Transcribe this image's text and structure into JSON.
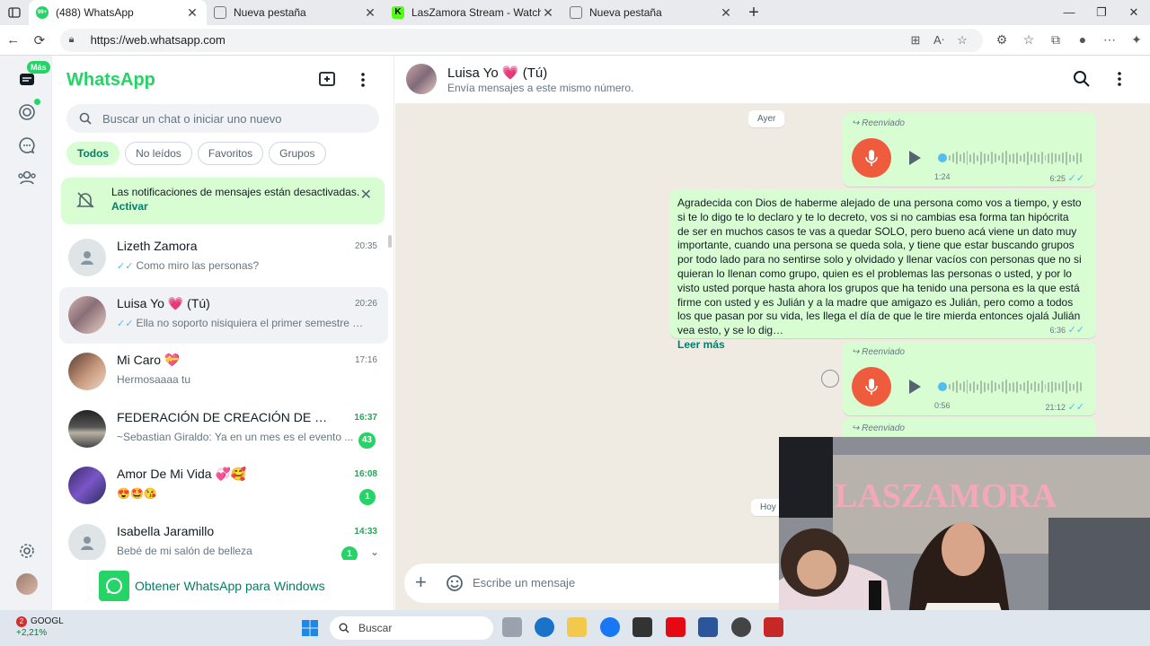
{
  "browser": {
    "tabs": [
      {
        "title": "(488) WhatsApp",
        "favicon_badge": "99+",
        "active": true
      },
      {
        "title": "Nueva pestaña",
        "active": false
      },
      {
        "title": "LasZamora Stream - Watch Live o",
        "active": false
      },
      {
        "title": "Nueva pestaña",
        "active": false
      }
    ],
    "url": "https://web.whatsapp.com"
  },
  "rail": {
    "mas_badge": "Más"
  },
  "sidebar": {
    "brand": "WhatsApp",
    "search_placeholder": "Buscar un chat o iniciar uno nuevo",
    "filters": [
      "Todos",
      "No leídos",
      "Favoritos",
      "Grupos"
    ],
    "notification": {
      "text": "Las notificaciones de mensajes están desactivadas.",
      "action": "Activar"
    },
    "chats": [
      {
        "name": "Lizeth Zamora",
        "time": "20:35",
        "preview": "Como miro las personas?",
        "ticks": "✓✓",
        "unread": "",
        "avatar": "generic"
      },
      {
        "name": "Luisa Yo 💗 (Tú)",
        "time": "20:26",
        "preview": "Ella no soporto nisiquiera el primer semestre de ...",
        "ticks": "✓✓",
        "unread": "",
        "avatar": "photo1"
      },
      {
        "name": "Mi Caro 💝",
        "time": "17:16",
        "preview": "Hermosaaaa tu",
        "ticks": "",
        "unread": "",
        "avatar": "photo2"
      },
      {
        "name": "FEDERACIÓN DE CREACIÓN DE CONTE...",
        "time": "16:37",
        "preview": "~Sebastian Giraldo: Ya en un mes es el evento ...",
        "ticks": "",
        "unread": "43",
        "avatar": "photo3"
      },
      {
        "name": "Amor De Mi Vida 💞🥰",
        "time": "16:08",
        "preview": "😍🤩😘",
        "ticks": "",
        "unread": "1",
        "avatar": "photo4"
      },
      {
        "name": "Isabella Jaramillo",
        "time": "14:33",
        "preview": "Bebé de mi salón de belleza",
        "ticks": "",
        "unread": "1",
        "avatar": "generic"
      }
    ],
    "get_app": "Obtener WhatsApp para Windows"
  },
  "conversation": {
    "name": "Luisa Yo 💗 (Tú)",
    "subtitle": "Envía mensajes a este mismo número.",
    "day_yesterday": "Ayer",
    "day_today": "Hoy",
    "forwarded": "Reenviado",
    "audio1": {
      "duration": "1:24",
      "time": "6:25"
    },
    "text_msg": {
      "body": "Agradecida con Dios de haberme alejado de una persona como vos a tiempo, y esto si te lo digo te lo declaro y te lo decreto, vos si no cambias esa forma tan hipócrita de ser en muchos casos te vas a quedar SOLO, pero bueno acá viene un dato muy importante, cuando una persona se queda sola, y tiene que estar buscando grupos por todo lado para no sentirse solo y olvidado y llenar vacíos con personas que no si quieran lo llenan como grupo, quien es el problemas las personas o usted, y por lo visto usted porque hasta ahora los grupos que ha tenido una persona es la que está firme con usted y es Julián y a la madre que amigazo es Julián, pero como a todos los que pasan por su vida, les llega el día de que le tire mierda entonces ojalá Julián vea esto, y se lo dig…",
      "read_more": "Leer más",
      "time": "6:36"
    },
    "audio2": {
      "duration": "0:56",
      "time": "21:12"
    },
    "composer_placeholder": "Escribe un mensaje"
  },
  "taskbar": {
    "stock_name": "GOOGL",
    "stock_change": "+2,21%",
    "notif_count": "2",
    "search": "Buscar"
  },
  "colors": {
    "accent": "#25d366",
    "bubble_out": "#d9fdd3",
    "chat_bg": "#efeae2",
    "mic": "#ef5b3d"
  }
}
